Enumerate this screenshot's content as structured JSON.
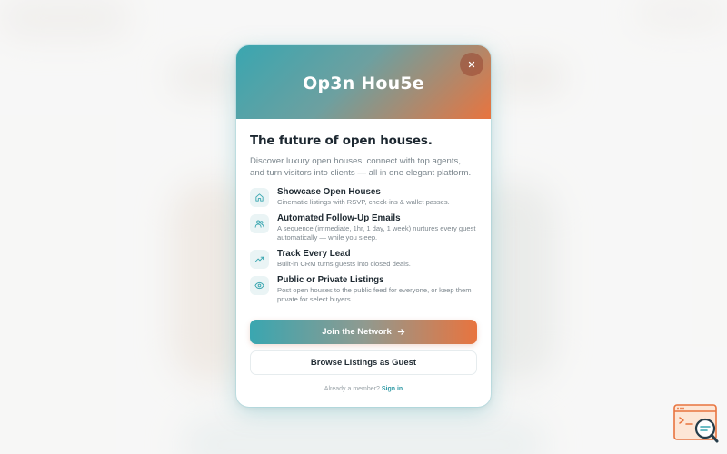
{
  "colors": {
    "gradient_start": "#3aa6b0",
    "gradient_end": "#e8743f",
    "accent_teal": "#2f9aa5",
    "icon_bg": "#eaf4f5"
  },
  "modal": {
    "title": "Op3n Hou5e",
    "close_icon": "close-icon",
    "headline": "The future of open houses.",
    "intro": "Discover luxury open houses, connect with top agents, and turn visitors into clients — all in one elegant platform.",
    "features": [
      {
        "icon": "home-icon",
        "title": "Showcase Open Houses",
        "desc": "Cinematic listings with RSVP, check-ins & wallet passes."
      },
      {
        "icon": "users-icon",
        "title": "Automated Follow-Up Emails",
        "desc": "A sequence (immediate, 1hr, 1 day, 1 week) nurtures every guest automatically — while you sleep."
      },
      {
        "icon": "trending-up-icon",
        "title": "Track Every Lead",
        "desc": "Built-in CRM turns guests into closed deals."
      },
      {
        "icon": "eye-icon",
        "title": "Public or Private Listings",
        "desc": "Post open houses to the public feed for everyone, or keep them private for select buyers."
      }
    ],
    "primary_button": "Join the Network",
    "primary_button_icon": "arrow-right-icon",
    "secondary_button": "Browse Listings as Guest",
    "signin_prompt": "Already a member?",
    "signin_link": "Sign in"
  },
  "help_widget": {
    "icon": "search-help-icon"
  }
}
